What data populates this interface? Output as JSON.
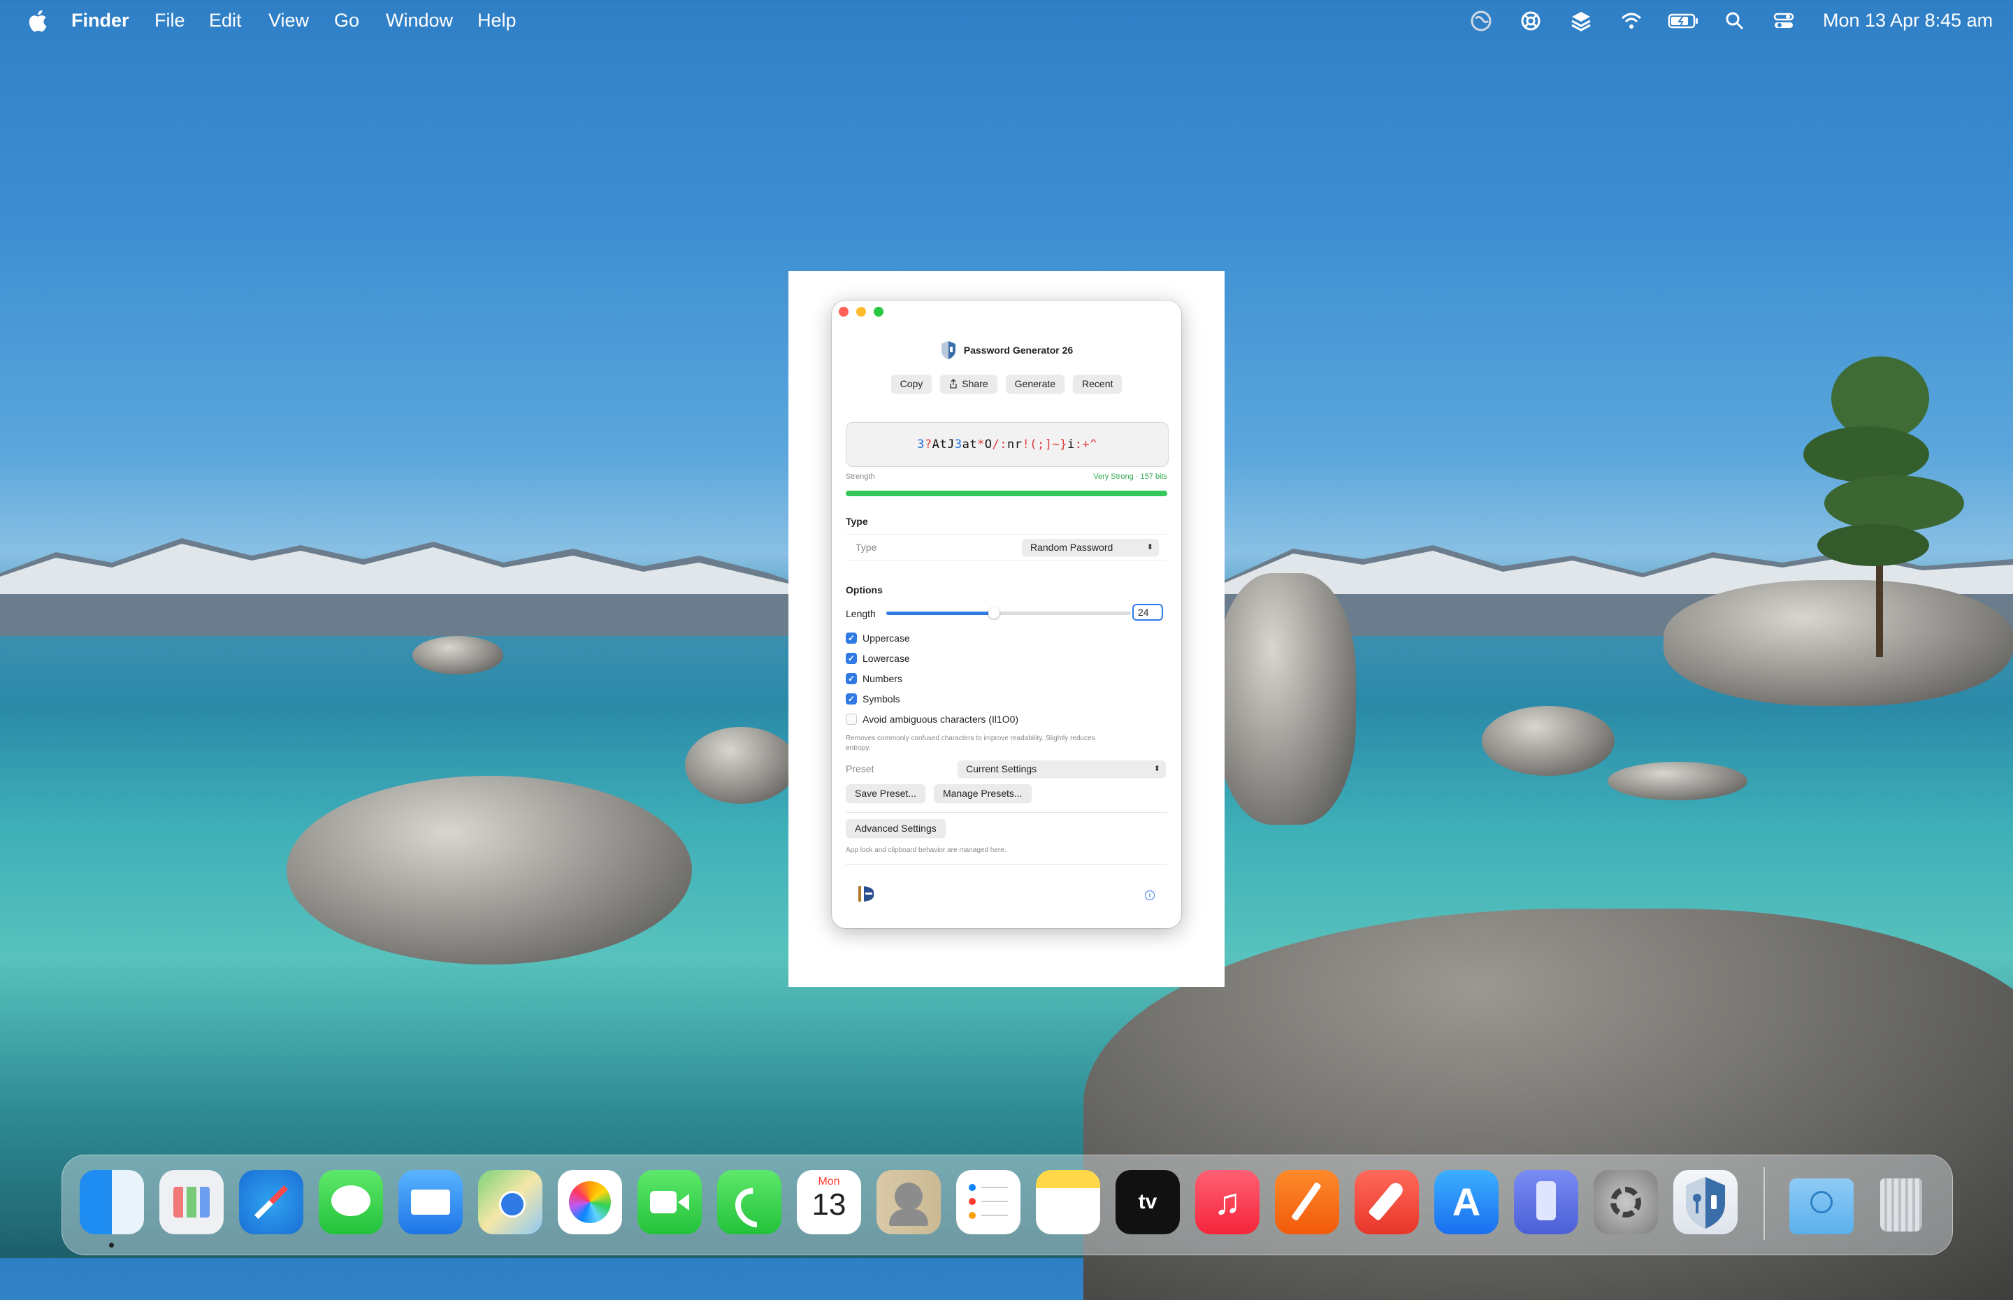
{
  "menubar": {
    "app_name": "Finder",
    "items": [
      "File",
      "Edit",
      "View",
      "Go",
      "Window",
      "Help"
    ],
    "clock": "Mon 13 Apr  8:45 am"
  },
  "window": {
    "title": "Password Generator 26",
    "toolbar": {
      "copy": "Copy",
      "share": "Share",
      "generate": "Generate",
      "recent": "Recent"
    },
    "password": {
      "segments": [
        {
          "t": "3",
          "k": "num"
        },
        {
          "t": "?",
          "k": "sym"
        },
        {
          "t": "AtJ",
          "k": "let"
        },
        {
          "t": "3",
          "k": "num"
        },
        {
          "t": "at",
          "k": "let"
        },
        {
          "t": "*",
          "k": "sym"
        },
        {
          "t": "O",
          "k": "let"
        },
        {
          "t": "/:",
          "k": "sym"
        },
        {
          "t": "nr",
          "k": "let"
        },
        {
          "t": "!(;]~}",
          "k": "sym"
        },
        {
          "t": "i",
          "k": "let"
        },
        {
          "t": ":+^",
          "k": "sym"
        }
      ]
    },
    "strength": {
      "label": "Strength",
      "value": "Very Strong · 157 bits",
      "level": 1.0,
      "color": "#34c759"
    },
    "type_section": {
      "title": "Type",
      "label": "Type",
      "selected": "Random Password"
    },
    "options": {
      "title": "Options",
      "length_label": "Length",
      "length_value": "24",
      "slider_fraction": 0.44,
      "uppercase": "Uppercase",
      "lowercase": "Lowercase",
      "numbers": "Numbers",
      "symbols": "Symbols",
      "avoid_ambiguous": "Avoid ambiguous characters (Il1O0)",
      "avoid_hint": "Removes commonly confused characters to improve readability. Slightly reduces entropy.",
      "checked": {
        "uppercase": true,
        "lowercase": true,
        "numbers": true,
        "symbols": true,
        "avoid_ambiguous": false
      }
    },
    "preset": {
      "label": "Preset",
      "selected": "Current Settings",
      "save": "Save Preset...",
      "manage": "Manage Presets..."
    },
    "advanced": {
      "button": "Advanced Settings",
      "hint": "App lock and clipboard behavior are managed here."
    }
  },
  "dock": {
    "calendar_month": "Mon",
    "calendar_day": "13",
    "apps": [
      "finder",
      "launchpad",
      "safari",
      "messages",
      "mail",
      "maps",
      "photos",
      "facetime",
      "phone",
      "calendar",
      "contacts",
      "reminders",
      "notes",
      "tv",
      "music",
      "pages",
      "rocket",
      "app-store",
      "iphone-mirroring",
      "system-settings",
      "password-generator"
    ]
  },
  "colors": {
    "accent": "#2f7ae5",
    "number": "#1f6fe0",
    "symbol": "#e03b3b"
  }
}
